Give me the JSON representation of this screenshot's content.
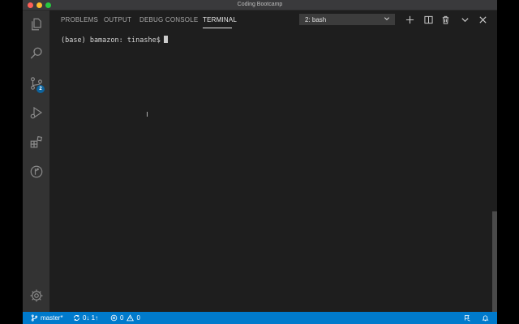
{
  "window": {
    "title": "Coding Bootcamp"
  },
  "activity_bar": {
    "items": [
      "explorer-icon",
      "search-icon",
      "source-control-icon",
      "run-debug-icon",
      "extensions-icon",
      "git-graph-icon"
    ],
    "source_control_badge": "2",
    "settings": "gear-icon"
  },
  "panel": {
    "tabs": [
      {
        "label": "PROBLEMS"
      },
      {
        "label": "OUTPUT"
      },
      {
        "label": "DEBUG CONSOLE"
      },
      {
        "label": "TERMINAL"
      }
    ],
    "active_tab": "TERMINAL",
    "terminal_select": {
      "value": "2: bash"
    }
  },
  "terminal": {
    "prompt": "(base) bamazon: tinashe$"
  },
  "status_bar": {
    "branch": "master*",
    "sync": "0↓ 1↑",
    "errors": "0",
    "warnings": "0"
  },
  "colors": {
    "status_bar": "#007acc",
    "activity_bar": "#333333",
    "editor_bg": "#1e1e1e",
    "badge": "#0e639c"
  }
}
